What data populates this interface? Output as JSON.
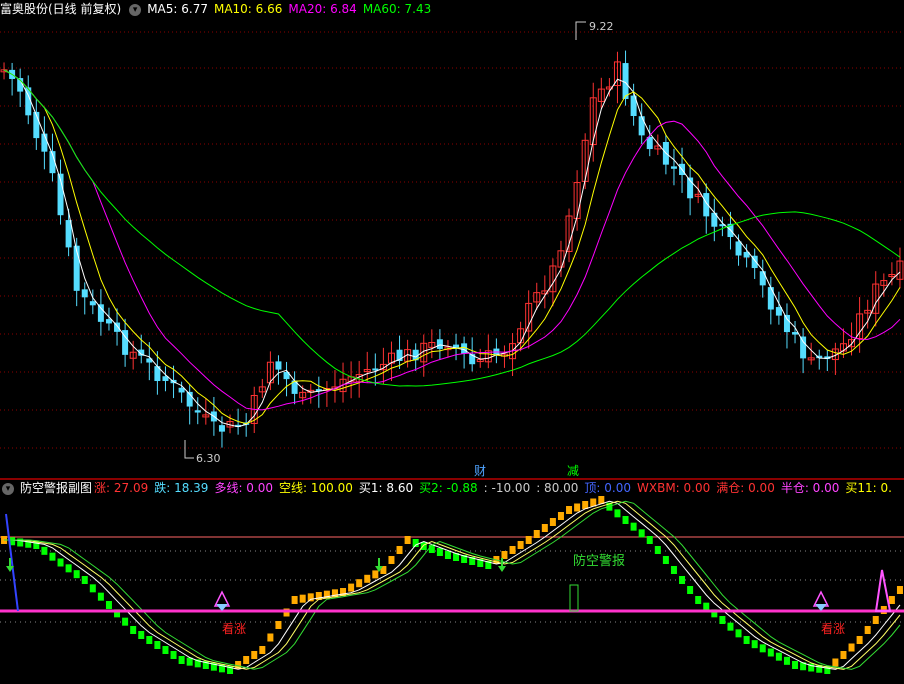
{
  "main_panel": {
    "title": "富奥股份(日线 前复权)",
    "indicators": [
      {
        "label": "MA5: 6.77",
        "color": "#ffffff"
      },
      {
        "label": "MA10: 6.66",
        "color": "#ffff00"
      },
      {
        "label": "MA20: 6.84",
        "color": "#ff00ff"
      },
      {
        "label": "MA60: 7.43",
        "color": "#00ff00"
      }
    ],
    "high_marker": "9.22",
    "low_marker": "6.30",
    "event_labels": [
      {
        "text": "财",
        "color": "#4fa3ff"
      },
      {
        "text": "减",
        "color": "#00ff00"
      }
    ]
  },
  "sub_panel": {
    "title": "防空警报副图",
    "indicators": [
      {
        "label": "涨: 27.09",
        "color": "#ff3333"
      },
      {
        "label": "跌: 18.39",
        "color": "#55ddff"
      },
      {
        "label": "多线: 0.00",
        "color": "#ff44ff"
      },
      {
        "label": "空线: 100.00",
        "color": "#ffff00"
      },
      {
        "label": "买1: 8.60",
        "color": "#ffffff"
      },
      {
        "label": "买2: -0.88",
        "color": "#00ff00"
      },
      {
        "label": ": -10.00",
        "color": "#cccccc"
      },
      {
        "label": ": 80.00",
        "color": "#cccccc"
      },
      {
        "label": "顶: 0.00",
        "color": "#4466ff"
      },
      {
        "label": "WXBM: 0.00",
        "color": "#ff3333"
      },
      {
        "label": "满仓: 0.00",
        "color": "#ff3333"
      },
      {
        "label": "半仓: 0.00",
        "color": "#ff44ff"
      },
      {
        "label": "买11: 0.",
        "color": "#ffff00"
      }
    ],
    "annotations": [
      {
        "text": "看涨",
        "color": "#ff2222"
      },
      {
        "text": "防空警报",
        "color": "#33dd33"
      },
      {
        "text": "看涨",
        "color": "#ff2222"
      }
    ]
  },
  "colors": {
    "up": "#ff3333",
    "down": "#55ddff",
    "grid": "#8b0000",
    "sub_up": "#ffaa00",
    "sub_down": "#00ff00"
  }
}
